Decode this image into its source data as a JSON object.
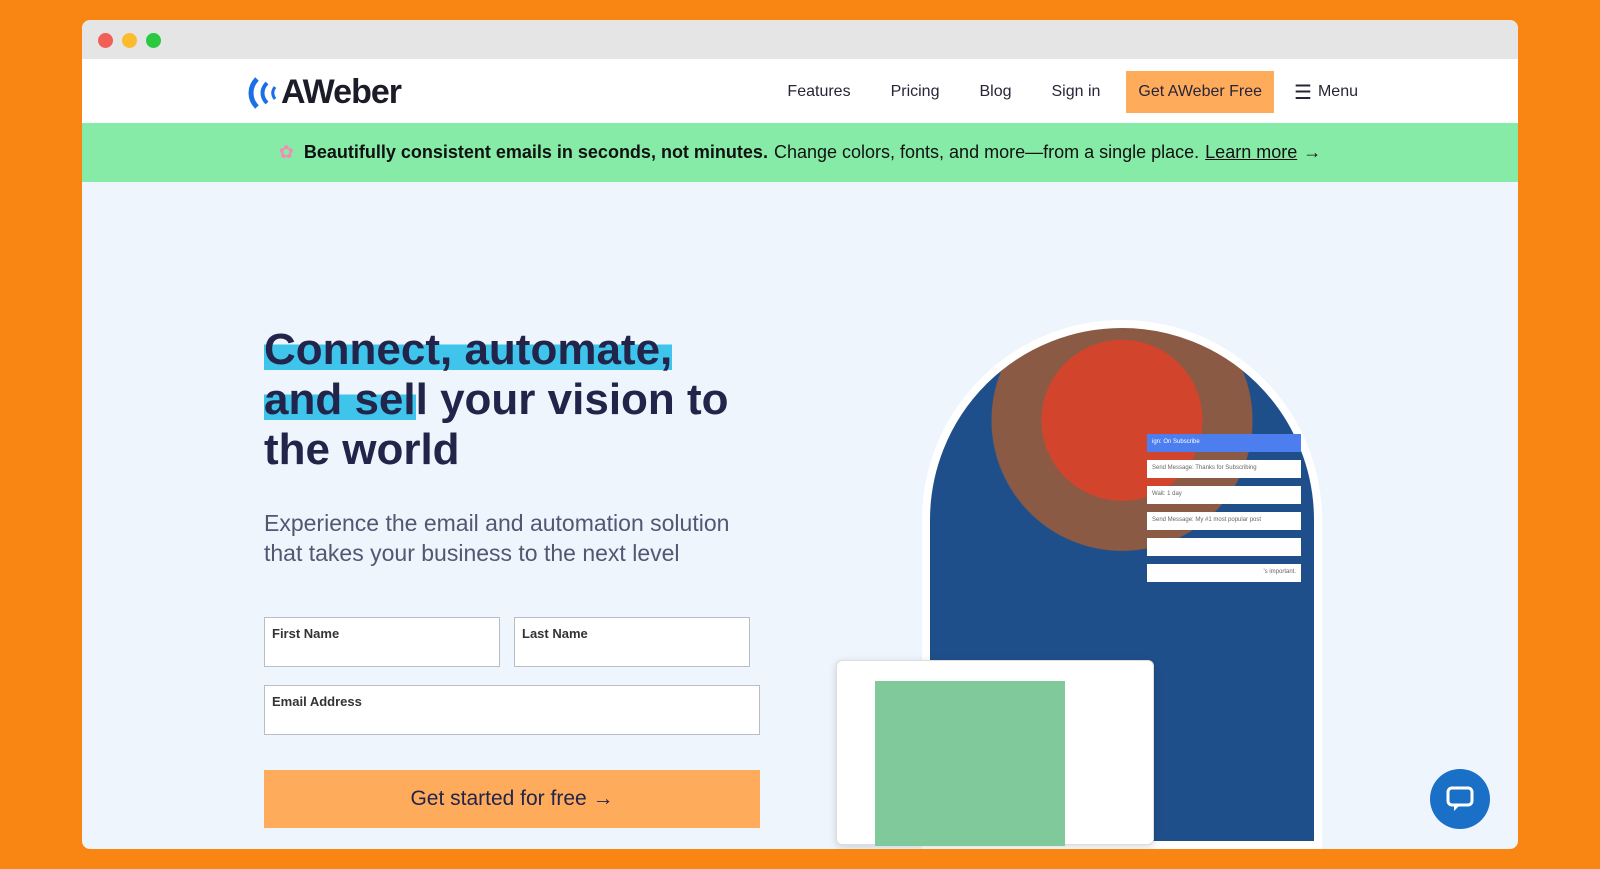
{
  "browser": {
    "dots": [
      "#f25f57",
      "#fcbb2d",
      "#2ac940"
    ]
  },
  "nav": {
    "logo": "AWeber",
    "links": [
      "Features",
      "Pricing",
      "Blog",
      "Sign in"
    ],
    "cta": "Get AWeber Free",
    "menu": "Menu"
  },
  "banner": {
    "bold": "Beautifully consistent emails in seconds, not minutes.",
    "text": "Change colors, fonts, and more—from a single place.",
    "link": "Learn more",
    "arrow": "→"
  },
  "hero": {
    "title_hl1": "Connect, automate,",
    "title_hl2": "and sel",
    "title_rest": "l your vision to the world",
    "subtitle": "Experience the email and automation solution that takes your business to the next level"
  },
  "form": {
    "first_name": "First Name",
    "last_name": "Last Name",
    "email": "Email Address",
    "submit": "Get started for free →"
  },
  "workflow": [
    "ign: On Subscribe",
    "Send Message: Thanks for Subscribing",
    "Wait: 1 day",
    "Send Message: My #1 most popular post",
    "",
    "'s important."
  ],
  "colors": {
    "accent": "#ffab5c",
    "banner": "#86eba6",
    "brand_blue": "#1a6fc7"
  }
}
